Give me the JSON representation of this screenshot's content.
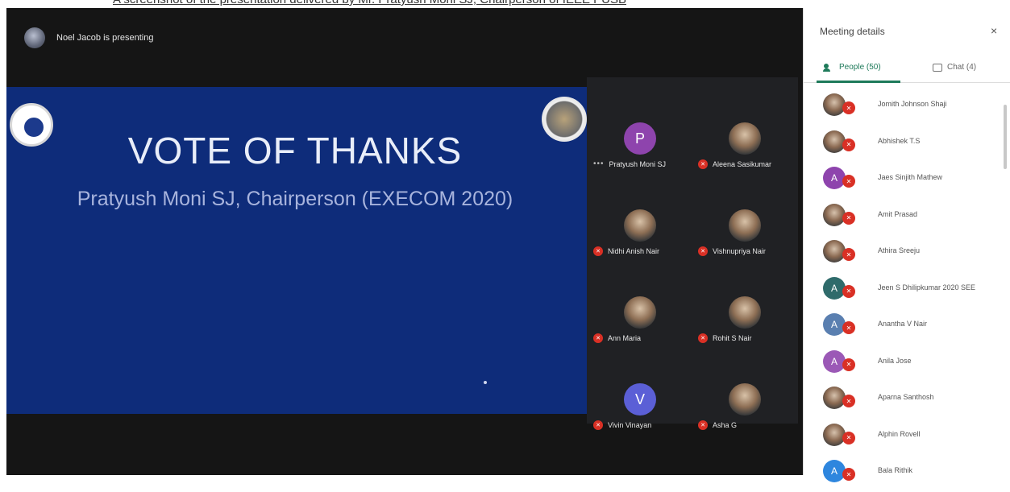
{
  "document": {
    "caption": "A screenshot of the presentation delivered by Mr. Pratyush Moni SJ, Chairperson of IEEE PUSB"
  },
  "meeting": {
    "presenting_label": "Noel Jacob is presenting"
  },
  "slide": {
    "title": "VOTE OF THANKS",
    "subtitle": "Pratyush Moni SJ, Chairperson (EXECOM 2020)"
  },
  "tiles": [
    {
      "name": "Pratyush Moni SJ",
      "avatar_type": "initial",
      "initial": "P",
      "color": "#8e44ad",
      "muted": false,
      "has_more": true
    },
    {
      "name": "Aleena Sasikumar",
      "avatar_type": "photo",
      "muted": true
    },
    {
      "name": "Nidhi Anish Nair",
      "avatar_type": "photo",
      "muted": true
    },
    {
      "name": "Vishnupriya Nair",
      "avatar_type": "photo",
      "muted": true
    },
    {
      "name": "Ann Maria",
      "avatar_type": "photo",
      "muted": true
    },
    {
      "name": "Rohit S Nair",
      "avatar_type": "photo",
      "muted": true
    },
    {
      "name": "Vivin Vinayan",
      "avatar_type": "initial",
      "initial": "V",
      "color": "#5b5fd6",
      "muted": true
    },
    {
      "name": "Asha G",
      "avatar_type": "photo",
      "muted": true
    }
  ],
  "panel": {
    "title": "Meeting details",
    "close_icon": "×",
    "tab_people": "People (50)",
    "tab_chat": "Chat (4)",
    "participants": [
      {
        "name": "Jomith Johnson Shaji",
        "avatar_type": "photo"
      },
      {
        "name": "Abhishek T.S",
        "avatar_type": "photo"
      },
      {
        "name": "Jaes Sinjith Mathew",
        "avatar_type": "initial",
        "initial": "A",
        "color": "#8e44ad"
      },
      {
        "name": "Amit Prasad",
        "avatar_type": "photo"
      },
      {
        "name": "Athira Sreeju",
        "avatar_type": "photo"
      },
      {
        "name": "Jeen S Dhilipkumar 2020 SEE",
        "avatar_type": "initial",
        "initial": "A",
        "color": "#2f6b6b"
      },
      {
        "name": "Anantha V Nair",
        "avatar_type": "initial",
        "initial": "A",
        "color": "#5a7fb0"
      },
      {
        "name": "Anila Jose",
        "avatar_type": "initial",
        "initial": "A",
        "color": "#9b59b6"
      },
      {
        "name": "Aparna Santhosh",
        "avatar_type": "photo"
      },
      {
        "name": "Alphin Rovell",
        "avatar_type": "photo"
      },
      {
        "name": "Bala Rithik",
        "avatar_type": "initial",
        "initial": "A",
        "color": "#2e86de"
      }
    ]
  },
  "icons": {
    "mic_off": "mic-off-icon",
    "people": "people-icon",
    "chat": "chat-icon",
    "more": "more-icon"
  },
  "colors": {
    "slide_bg": "#0e2c7a",
    "accent": "#1e7a5a",
    "muted": "#d93025"
  }
}
